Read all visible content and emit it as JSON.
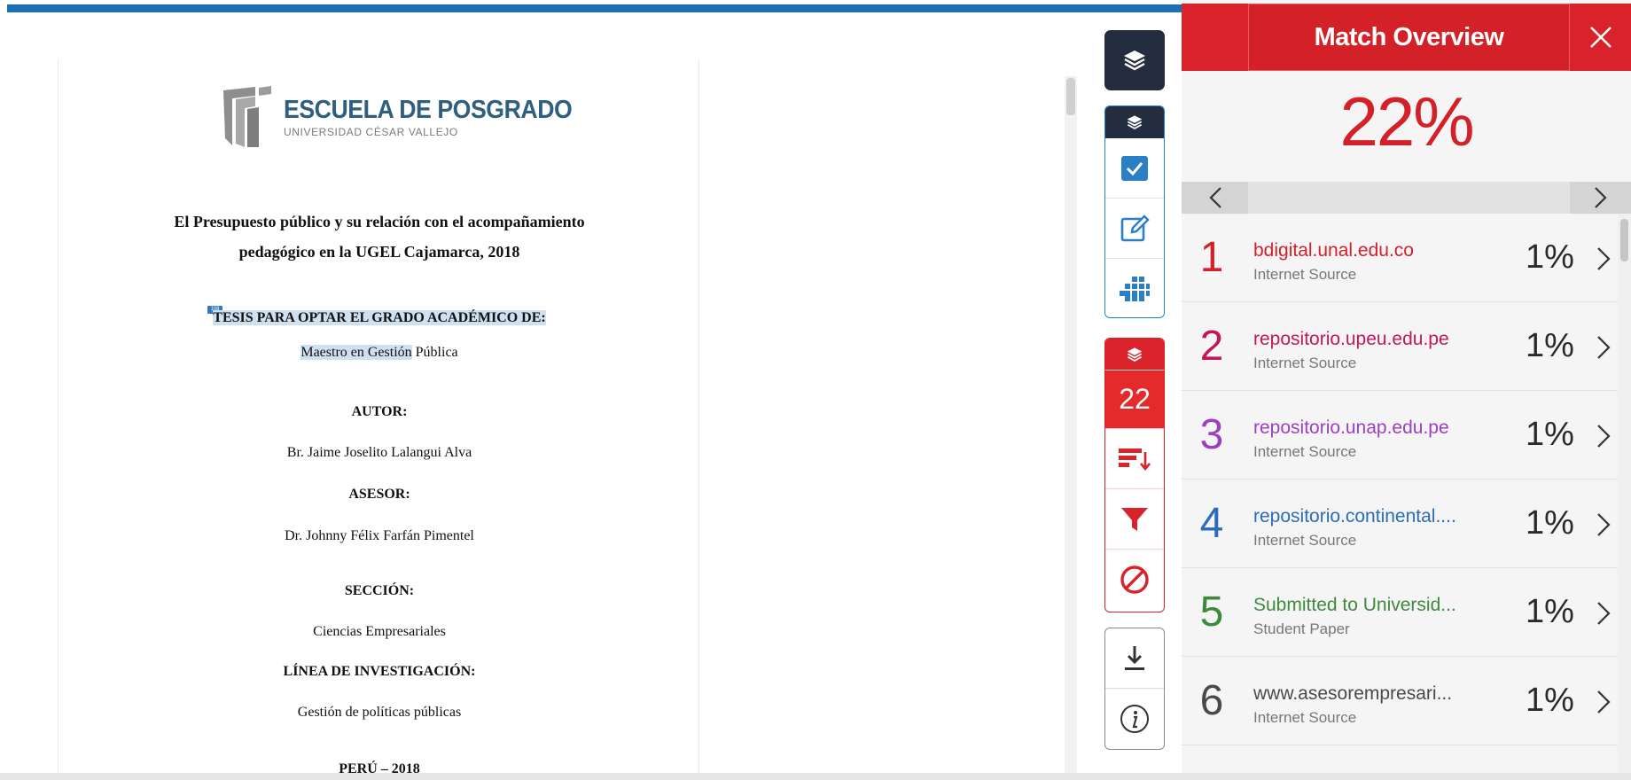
{
  "document": {
    "logo": {
      "title": "ESCUELA DE POSGRADO",
      "subtitle": "Universidad César Vallejo"
    },
    "title_line1": "El Presupuesto público y su relación con el acompañamiento",
    "title_line2": "pedagógico en la UGEL Cajamarca, 2018",
    "match_pin": "108",
    "thesis_label": "TESIS PARA OPTAR EL GRADO ACADÉMICO DE:",
    "degree_highlighted": "Maestro en Gestión",
    "degree_rest": " Pública",
    "author_label": "AUTOR:",
    "author": "Br.  Jaime Joselito Lalangui Alva",
    "advisor_label": "ASESOR:",
    "advisor": "Dr. Johnny Félix Farfán Pimentel",
    "section_label": "SECCIÓN:",
    "section": "Ciencias Empresariales",
    "research_label": "LÍNEA DE INVESTIGACIÓN:",
    "research": "Gestión de políticas públicas",
    "footer": "PERÚ – 2018"
  },
  "rail": {
    "match_count": "22",
    "icons": [
      "layers-icon",
      "checkbox-icon",
      "edit-icon",
      "grid-icon",
      "sort-icon",
      "filter-icon",
      "exclude-icon",
      "download-icon",
      "info-icon"
    ]
  },
  "panel": {
    "title": "Match Overview",
    "percentage": "22%",
    "matches": [
      {
        "rank": "1",
        "source": "bdigital.unal.edu.co",
        "type": "Internet Source",
        "percent": "1%",
        "color": "#d3212a"
      },
      {
        "rank": "2",
        "source": "repositorio.upeu.edu.pe",
        "type": "Internet Source",
        "percent": "1%",
        "color": "#c2185b"
      },
      {
        "rank": "3",
        "source": "repositorio.unap.edu.pe",
        "type": "Internet Source",
        "percent": "1%",
        "color": "#9c3fc0"
      },
      {
        "rank": "4",
        "source": "repositorio.continental....",
        "type": "Internet Source",
        "percent": "1%",
        "color": "#2a6cb8"
      },
      {
        "rank": "5",
        "source": "Submitted to Universid...",
        "type": "Student Paper",
        "percent": "1%",
        "color": "#3d8a3d"
      },
      {
        "rank": "6",
        "source": "www.asesorempresari...",
        "type": "Internet Source",
        "percent": "1%",
        "color": "#4a4a4a"
      }
    ]
  },
  "colors": {
    "accent_red": "#d9222a",
    "accent_blue": "#1a6fb5",
    "dark": "#232d3f"
  }
}
